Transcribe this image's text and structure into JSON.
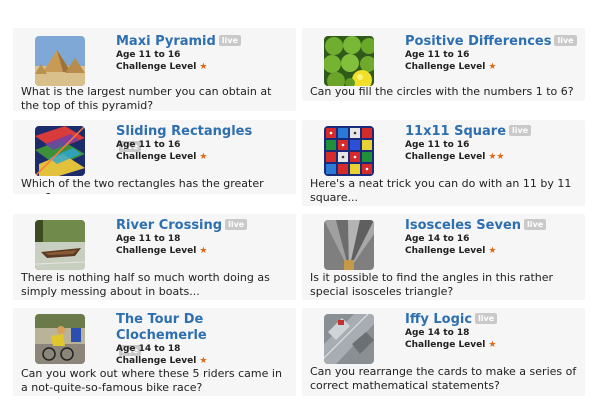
{
  "cards": [
    {
      "title": "Maxi Pyramid",
      "badge": "live",
      "age": "Age 11 to 16",
      "level_label": "Challenge Level",
      "stars": "★",
      "description": "What is the largest number you can obtain at the top of this pyramid?",
      "image_icon": "pyramid-photo"
    },
    {
      "title": "Positive Differences",
      "badge": "live",
      "age": "Age 11 to 16",
      "level_label": "Challenge Level",
      "stars": "★",
      "description": "Can you fill the circles with the numbers 1 to 6?",
      "image_icon": "limes-photo"
    },
    {
      "title": "Sliding Rectangles",
      "badge": "live",
      "age": "Age 11 to 16",
      "level_label": "Challenge Level",
      "stars": "★",
      "description": "Which of the two rectangles has the greater area?",
      "image_icon": "rectangles-photo"
    },
    {
      "title": "11x11 Square",
      "badge": "live",
      "age": "Age 11 to 16",
      "level_label": "Challenge Level",
      "stars": "★★",
      "description": "Here's a neat trick you can do with an 11 by 11 square...",
      "image_icon": "dice-photo"
    },
    {
      "title": "River Crossing",
      "badge": "live",
      "age": "Age 11 to 18",
      "level_label": "Challenge Level",
      "stars": "★",
      "description": "There is nothing half so much worth doing as simply messing about in boats...",
      "image_icon": "boat-photo"
    },
    {
      "title": "Isosceles Seven",
      "badge": "live",
      "age": "Age 14 to 16",
      "level_label": "Challenge Level",
      "stars": "★",
      "description": "Is it possible to find the angles in this rather special isosceles triangle?",
      "image_icon": "fan-photo"
    },
    {
      "title": "The Tour De Clochemerle",
      "badge": "live",
      "age": "Age 14 to 18",
      "level_label": "Challenge Level",
      "stars": "★",
      "description": "Can you work out where these 5 riders came in a not-quite-so-famous bike race?",
      "image_icon": "cyclists-photo"
    },
    {
      "title": "Iffy Logic",
      "badge": "live",
      "age": "Age 14 to 18",
      "level_label": "Challenge Level",
      "stars": "★",
      "description": "Can you rearrange the cards to make a series of correct mathematical statements?",
      "image_icon": "cards-photo"
    }
  ],
  "colors": {
    "title": "#2e6fb0",
    "star": "#e06a16",
    "badge": "#c9c9c9",
    "card_bg": "#f6f6f6"
  }
}
